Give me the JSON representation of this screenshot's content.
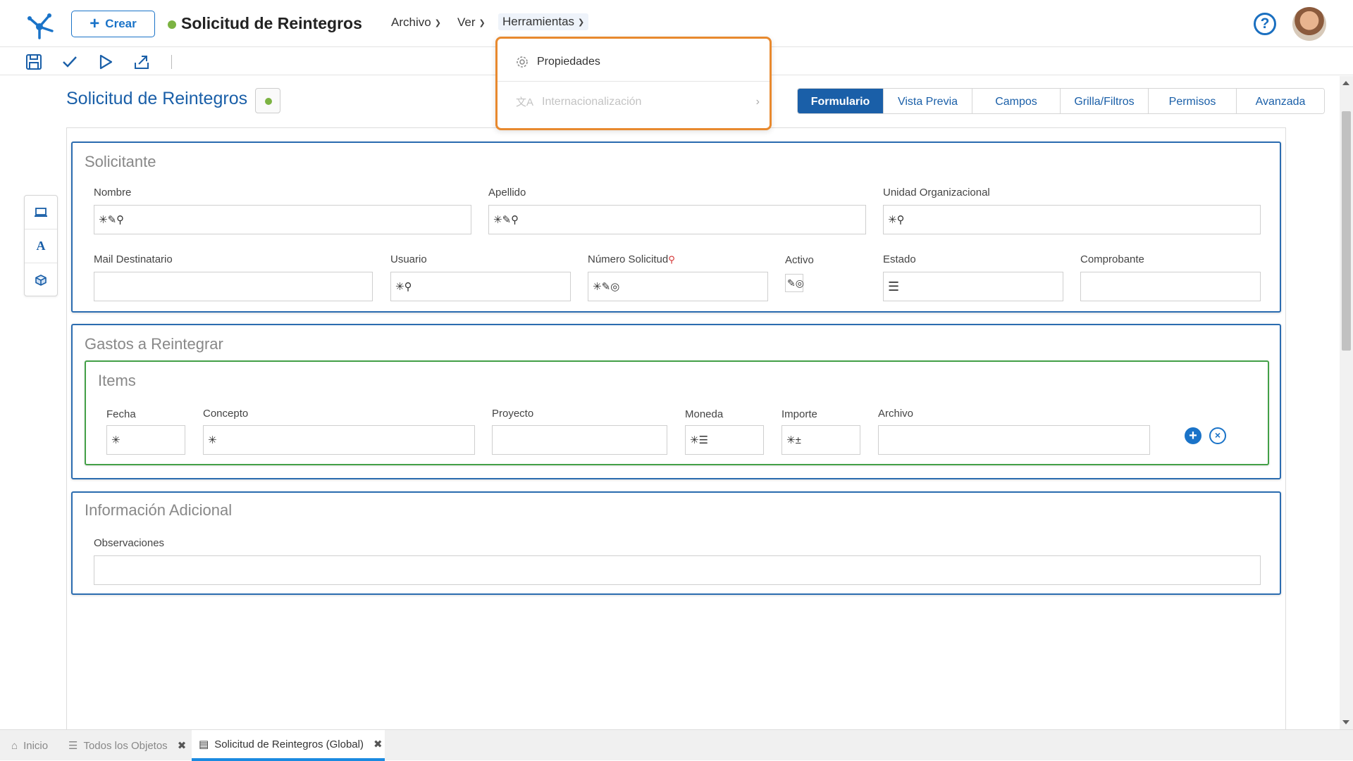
{
  "header": {
    "create_label": "Crear",
    "app_title": "Solicitud de Reintegros",
    "menus": [
      {
        "label": "Archivo"
      },
      {
        "label": "Ver"
      },
      {
        "label": "Herramientas"
      }
    ],
    "help_label": "?",
    "status_color": "#7cb342"
  },
  "dropdown": {
    "items": [
      {
        "label": "Propiedades",
        "icon": "gear-icon",
        "enabled": true
      },
      {
        "label": "Internacionalización",
        "icon": "translate-icon",
        "enabled": false
      }
    ]
  },
  "toolbar": {
    "icons": [
      "save-icon",
      "check-icon",
      "play-icon",
      "export-icon"
    ]
  },
  "form": {
    "title": "Solicitud de Reintegros",
    "tabs": [
      "Formulario",
      "Vista Previa",
      "Campos",
      "Grilla/Filtros",
      "Permisos",
      "Avanzada"
    ],
    "active_tab": "Formulario"
  },
  "side_tools": [
    "laptop-icon",
    "text-icon",
    "cube-icon"
  ],
  "sections": {
    "solicitante": {
      "title": "Solicitante",
      "fields": {
        "nombre": {
          "label": "Nombre",
          "icons": "✳✎⚲"
        },
        "apellido": {
          "label": "Apellido",
          "icons": "✳✎⚲"
        },
        "unidad": {
          "label": "Unidad Organizacional",
          "icons": "✳⚲"
        },
        "mail": {
          "label": "Mail Destinatario",
          "icons": ""
        },
        "usuario": {
          "label": "Usuario",
          "icons": "✳⚲"
        },
        "numero": {
          "label": "Número Solicitud",
          "icons": "✳✎◎"
        },
        "activo": {
          "label": "Activo",
          "icons": "✎◎"
        },
        "estado": {
          "label": "Estado",
          "icons": "☰"
        },
        "comprobante": {
          "label": "Comprobante",
          "icons": ""
        }
      }
    },
    "gastos": {
      "title": "Gastos a Reintegrar",
      "grid_title": "Items",
      "columns": {
        "fecha": {
          "label": "Fecha",
          "icons": "✳"
        },
        "concepto": {
          "label": "Concepto",
          "icons": "✳"
        },
        "proyecto": {
          "label": "Proyecto",
          "icons": ""
        },
        "moneda": {
          "label": "Moneda",
          "icons": "✳☰"
        },
        "importe": {
          "label": "Importe",
          "icons": "✳±"
        },
        "archivo": {
          "label": "Archivo",
          "icons": ""
        }
      },
      "add_label": "+",
      "remove_label": "×"
    },
    "info": {
      "title": "Información Adicional",
      "fields": {
        "observaciones": {
          "label": "Observaciones",
          "icons": ""
        }
      }
    }
  },
  "bottom_tabs": [
    {
      "label": "Inicio",
      "icon": "home-icon"
    },
    {
      "label": "Todos los Objetos",
      "icon": "list-icon"
    },
    {
      "label": "Solicitud de Reintegros (Global)",
      "icon": "form-icon"
    }
  ],
  "bottom_tab_close": "✖"
}
